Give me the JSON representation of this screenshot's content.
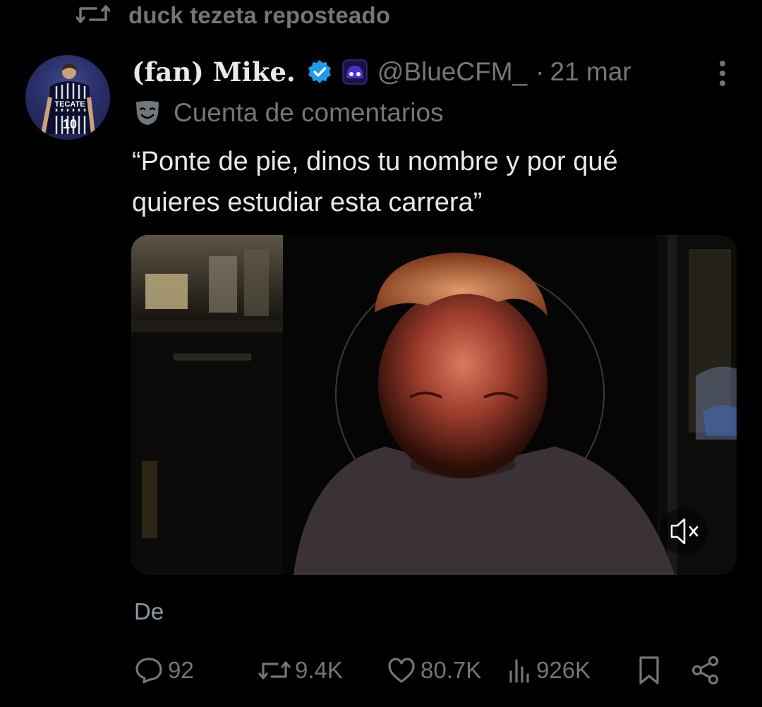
{
  "repost": {
    "label": "duck tezeta reposteado"
  },
  "author": {
    "display_name": "(fan) Mike.",
    "handle": "@BlueCFM_",
    "separator": "·",
    "date": "21 mar",
    "jersey_text": "TECATE",
    "jersey_number": "10"
  },
  "account_label": {
    "text": "Cuenta de comentarios"
  },
  "tweet": {
    "text_line1": "“Ponte de pie, dinos tu nombre y por qué",
    "text_line2": "quieres estudiar esta carrera”"
  },
  "media": {
    "type": "video",
    "muted": true
  },
  "from_label": "De",
  "actions": {
    "replies": "92",
    "reposts": "9.4K",
    "likes": "80.7K",
    "views": "926K"
  },
  "colors": {
    "background": "#000000",
    "text": "#e7e9ea",
    "secondary_text": "#71767b",
    "verified": "#1d9bf0",
    "badge": "#4b2fd6"
  }
}
